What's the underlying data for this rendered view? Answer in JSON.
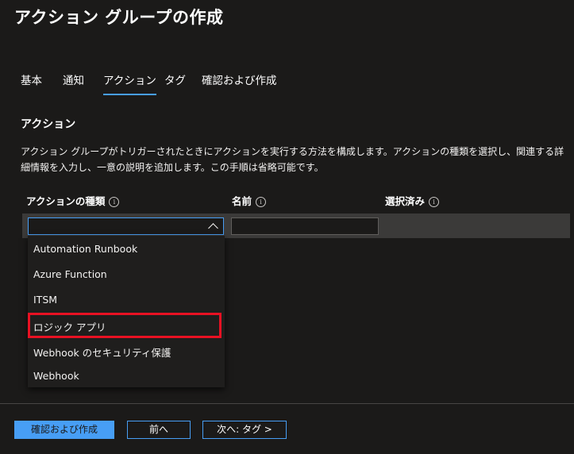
{
  "page": {
    "title": "アクション グループの作成"
  },
  "tabs": [
    {
      "label": "基本"
    },
    {
      "label": "通知"
    },
    {
      "label": "アクション",
      "active": true
    },
    {
      "label": "タグ"
    },
    {
      "label": "確認および作成"
    }
  ],
  "section": {
    "title": "アクション",
    "description": "アクション グループがトリガーされたときにアクションを実行する方法を構成します。アクションの種類を選択し、関連する詳細情報を入力し、一意の説明を追加します。この手順は省略可能です。"
  },
  "columns": {
    "type": "アクションの種類",
    "name": "名前",
    "selected": "選択済み",
    "info_glyph": "i"
  },
  "row": {
    "type_value": "",
    "name_value": ""
  },
  "dropdown": {
    "expanded": true,
    "options": [
      "Automation Runbook",
      "Azure Function",
      "ITSM",
      "ロジック アプリ",
      "Webhook のセキュリティ保護",
      "Webhook"
    ],
    "highlighted_option": "ロジック アプリ"
  },
  "footer": {
    "review_create": "確認および作成",
    "previous": "前へ",
    "next": "次へ: タグ >"
  },
  "colors": {
    "background": "#1b1a19",
    "accent": "#479ef5",
    "highlight_border": "#e81123",
    "row_background": "#3b3a39"
  }
}
